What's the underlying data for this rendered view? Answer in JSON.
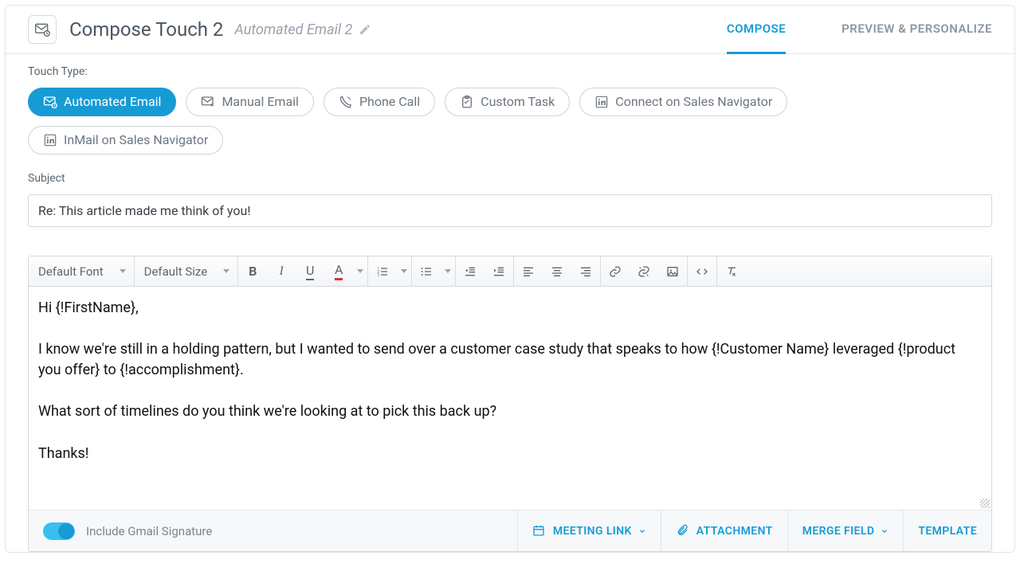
{
  "header": {
    "title": "Compose Touch 2",
    "subtitle": "Automated Email 2",
    "tabs": {
      "compose": "COMPOSE",
      "preview": "PREVIEW & PERSONALIZE"
    }
  },
  "touchType": {
    "label": "Touch Type:",
    "options": {
      "automated": "Automated Email",
      "manual": "Manual Email",
      "phone": "Phone Call",
      "task": "Custom Task",
      "connect": "Connect on Sales Navigator",
      "inmail": "InMail on Sales Navigator"
    }
  },
  "subject": {
    "label": "Subject",
    "value": "Re: This article made me think of you!"
  },
  "toolbar": {
    "font": "Default Font",
    "size": "Default Size",
    "icons": {
      "bold": "B",
      "italic": "I",
      "underline": "U",
      "textcolor": "A"
    }
  },
  "body": {
    "l1": "Hi {!FirstName},",
    "l2": "I know we're still in a holding pattern, but I wanted to send over a customer case study that speaks to how {!Customer Name} leveraged {!product you offer} to {!accomplishment}.",
    "l3": "What sort of timelines do you think we're looking at to pick this back up?",
    "l4": "Thanks!"
  },
  "footer": {
    "signature": "Include Gmail Signature",
    "meeting": "MEETING LINK",
    "attachment": "ATTACHMENT",
    "merge": "MERGE FIELD",
    "template": "TEMPLATE"
  }
}
